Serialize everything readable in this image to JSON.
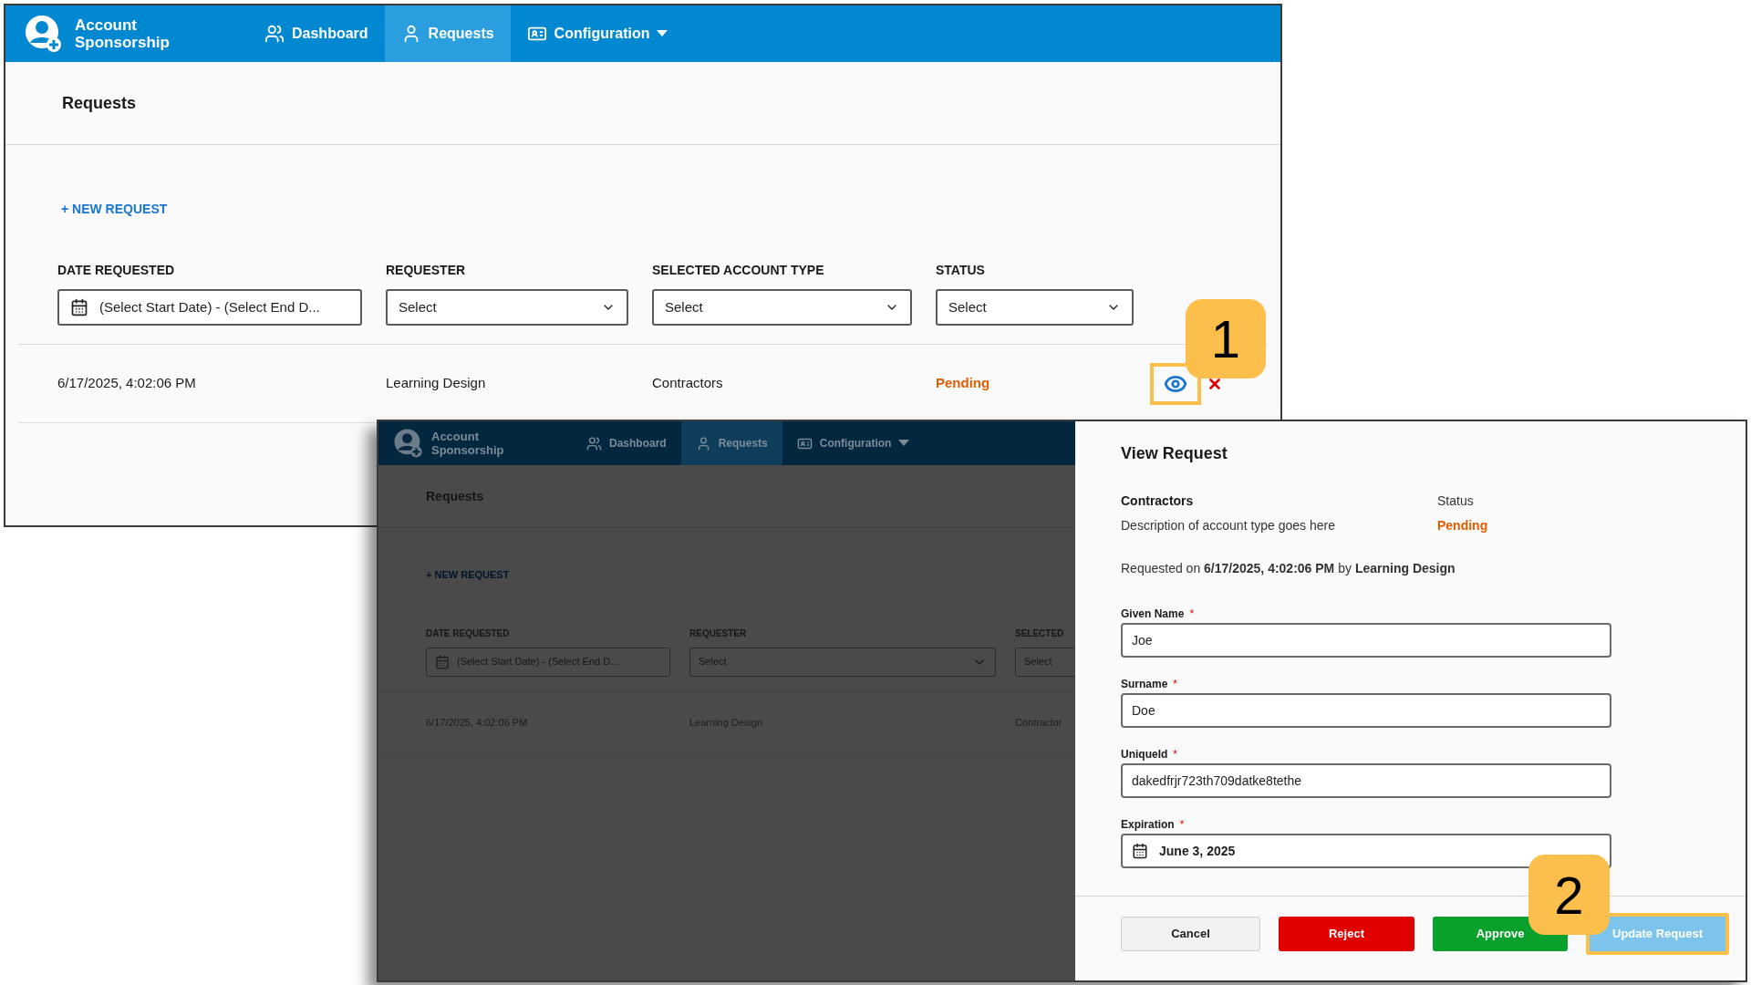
{
  "main_screen": {
    "app_title": "Account Sponsorship",
    "nav": [
      {
        "label": "Dashboard",
        "kind": "people",
        "selected": false,
        "dropdown": false
      },
      {
        "label": "Requests",
        "kind": "person",
        "selected": true,
        "dropdown": false
      },
      {
        "label": "Configuration",
        "kind": "card",
        "selected": false,
        "dropdown": true
      }
    ],
    "page_title": "Requests",
    "new_request": "+ NEW REQUEST",
    "filters": [
      {
        "label": "DATE REQUESTED",
        "kind": "date",
        "value": "(Select Start Date) - (Select End D..."
      },
      {
        "label": "REQUESTER",
        "kind": "select",
        "value": "Select"
      },
      {
        "label": "SELECTED ACCOUNT TYPE",
        "kind": "select",
        "value": "Select"
      },
      {
        "label": "STATUS",
        "kind": "select",
        "value": "Select"
      }
    ],
    "rows": [
      {
        "date": "6/17/2025, 4:02:06 PM",
        "requester": "Learning Design",
        "account_type": "Contractors",
        "status": "Pending",
        "actions": [
          {
            "kind": "view",
            "highlighted": true
          },
          {
            "kind": "delete",
            "highlighted": false
          }
        ]
      }
    ],
    "callout": "1"
  },
  "dimmed_screen": {
    "app_title": "Account Sponsorship",
    "nav": [
      {
        "label": "Dashboard",
        "kind": "people",
        "selected": false,
        "dropdown": false
      },
      {
        "label": "Requests",
        "kind": "person",
        "selected": true,
        "dropdown": false
      },
      {
        "label": "Configuration",
        "kind": "card",
        "selected": false,
        "dropdown": true
      }
    ],
    "page_title": "Requests",
    "new_request": "+ NEW REQUEST",
    "filters": [
      {
        "label": "DATE REQUESTED",
        "kind": "date",
        "value": "(Select Start Date) - (Select End D..."
      },
      {
        "label": "REQUESTER",
        "kind": "select",
        "value": "Select"
      },
      {
        "label": "SELECTED",
        "kind": "select",
        "value": "Select"
      }
    ],
    "rows": [
      {
        "date": "6/17/2025, 4:02:06 PM",
        "requester": "Learning Design",
        "account_type": "Contractor"
      }
    ]
  },
  "dialog": {
    "title": "View Request",
    "account_type": "Contractors",
    "description": "Description of account type goes here",
    "status_label": "Status",
    "status": "Pending",
    "requested": "Requested on **6/17/2025, 4:02:06 PM** by **Learning Design**",
    "fields": [
      {
        "label": "Given Name",
        "required_mark": "*",
        "kind": "text",
        "value": "Joe"
      },
      {
        "label": "Surname",
        "required_mark": "*",
        "kind": "text",
        "value": "Doe"
      },
      {
        "label": "UniqueId",
        "required_mark": "*",
        "kind": "text",
        "value": "dakedfrjr723th709datke8tethe"
      },
      {
        "label": "Expiration",
        "required_mark": "*",
        "kind": "date",
        "value": "June 3, 2025"
      }
    ],
    "buttons": [
      {
        "label": "Cancel",
        "kind": "cancel",
        "highlighted": false
      },
      {
        "label": "Reject",
        "kind": "reject",
        "highlighted": false
      },
      {
        "label": "Approve",
        "kind": "approve",
        "highlighted": false
      },
      {
        "label": "Update Request",
        "kind": "update",
        "highlighted": true
      }
    ],
    "callout": "2"
  }
}
